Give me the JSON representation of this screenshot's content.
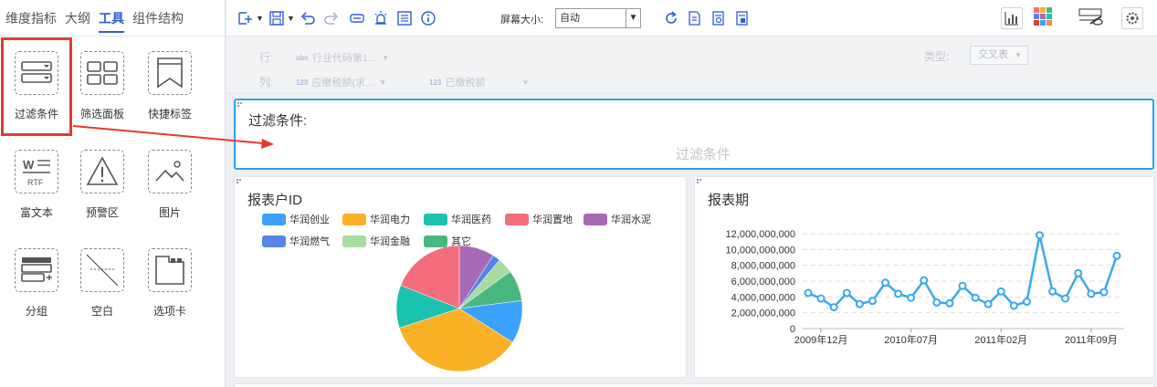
{
  "left_panel": {
    "tabs": [
      {
        "label": "维度指标"
      },
      {
        "label": "大纲"
      },
      {
        "label": "工具"
      },
      {
        "label": "组件结构"
      }
    ],
    "tools": [
      {
        "label": "过滤条件",
        "icon": "filter-condition-icon"
      },
      {
        "label": "筛选面板",
        "icon": "filter-panel-icon"
      },
      {
        "label": "快捷标签",
        "icon": "bookmark-icon"
      },
      {
        "label": "富文本",
        "icon": "rich-text-icon"
      },
      {
        "label": "预警区",
        "icon": "warning-icon"
      },
      {
        "label": "图片",
        "icon": "image-icon"
      },
      {
        "label": "分组",
        "icon": "group-icon"
      },
      {
        "label": "空白",
        "icon": "blank-icon"
      },
      {
        "label": "选项卡",
        "icon": "tabs-icon"
      }
    ]
  },
  "toolbar": {
    "screen_size_label": "屏幕大小:",
    "screen_size_value": "自动",
    "icon_names": [
      "new-icon",
      "save-icon",
      "undo-icon",
      "redo-icon",
      "link-icon",
      "alert-icon",
      "list-icon",
      "info-icon",
      "refresh-icon",
      "export-icon",
      "report-icon",
      "settings-report-icon",
      "chart-icon",
      "palette-icon",
      "hide-icon",
      "gear-icon"
    ]
  },
  "rowcol": {
    "row_label": "行:",
    "row_fields": [
      {
        "type_tag": "abc",
        "name": "行业代码第1..."
      }
    ],
    "col_label": "列:",
    "col_fields": [
      {
        "type_tag": "123",
        "name": "应缴税额(求..."
      },
      {
        "type_tag": "123",
        "name": "已缴税额"
      }
    ],
    "type_label": "类型:",
    "type_value": "交叉表"
  },
  "filter_widget": {
    "title": "过滤条件:",
    "placeholder": "过滤条件"
  },
  "report_id_widget": {
    "title": "报表户ID"
  },
  "report_period_widget": {
    "title": "报表期"
  },
  "colors": {
    "accent": "#2f5bd7",
    "highlight": "#e53935",
    "selected_border": "#2aa3e7",
    "line": "#3aa8f0"
  },
  "chart_data": [
    {
      "type": "pie",
      "legend": [
        "华润创业",
        "华润电力",
        "华润医药",
        "华润置地",
        "华润水泥",
        "华润燃气",
        "华润金融",
        "其它"
      ],
      "colors": [
        "#3ba1ff",
        "#fbb126",
        "#1bc2b0",
        "#f56d7b",
        "#a66ab4",
        "#5586e4",
        "#a8dca0",
        "#49b880"
      ],
      "values": [
        11,
        36,
        11,
        19,
        9,
        2,
        4,
        8
      ]
    },
    {
      "type": "line",
      "title": "",
      "ylim": [
        0,
        12000000000
      ],
      "yticks": [
        "0",
        "2,000,000,000",
        "4,000,000,000",
        "6,000,000,000",
        "8,000,000,000",
        "10,000,000,000",
        "12,000,000,000"
      ],
      "xticks": [
        "2009年12月",
        "2010年07月",
        "2011年02月",
        "2011年09月"
      ],
      "grid": "dashed horizontal",
      "values": [
        4500000000,
        3800000000,
        2700000000,
        4500000000,
        3100000000,
        3500000000,
        5800000000,
        4400000000,
        3900000000,
        6100000000,
        3300000000,
        3200000000,
        5400000000,
        3900000000,
        3100000000,
        4700000000,
        2900000000,
        3400000000,
        11800000000,
        4700000000,
        3800000000,
        7000000000,
        4400000000,
        4600000000,
        9200000000
      ]
    }
  ]
}
